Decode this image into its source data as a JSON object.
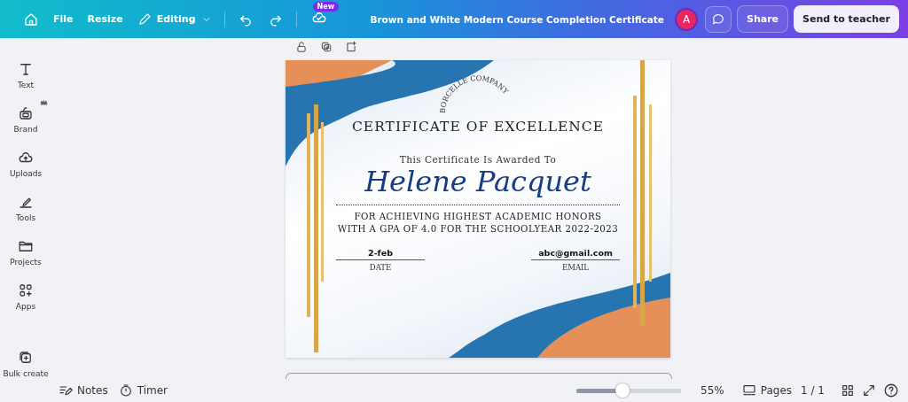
{
  "topbar": {
    "menu": [
      "File",
      "Resize"
    ],
    "mode": "Editing",
    "new_badge": "New",
    "title": "Brown and White Modern Course Completion Certificate",
    "avatar": "A",
    "share": "Share",
    "send": "Send to teacher"
  },
  "sidebar": {
    "items": [
      {
        "label": "Text",
        "kind": "text"
      },
      {
        "label": "Brand",
        "kind": "brand"
      },
      {
        "label": "Uploads",
        "kind": "uploads"
      },
      {
        "label": "Tools",
        "kind": "tools"
      },
      {
        "label": "Projects",
        "kind": "projects"
      },
      {
        "label": "Apps",
        "kind": "apps"
      },
      {
        "label": "Bulk create",
        "kind": "bulk"
      }
    ]
  },
  "certificate": {
    "company": "BORCELLE COMPANY",
    "title": "CERTIFICATE OF EXCELLENCE",
    "awarded": "This Certificate Is Awarded To",
    "name": "Helene Pacquet",
    "lines": [
      "FOR ACHIEVING HIGHEST ACADEMIC HONORS",
      "WITH A GPA OF 4.0 FOR THE SCHOOLYEAR 2022-2023"
    ],
    "fields": [
      {
        "value": "2-feb",
        "label": "DATE"
      },
      {
        "value": "abc@gmail.com",
        "label": "EMAIL"
      }
    ]
  },
  "footer": {
    "notes": "Notes",
    "timer": "Timer",
    "zoom": {
      "level": 0.44
    },
    "zoom_reading": "55%",
    "pages": "Pages",
    "page_count": "1 / 1"
  }
}
